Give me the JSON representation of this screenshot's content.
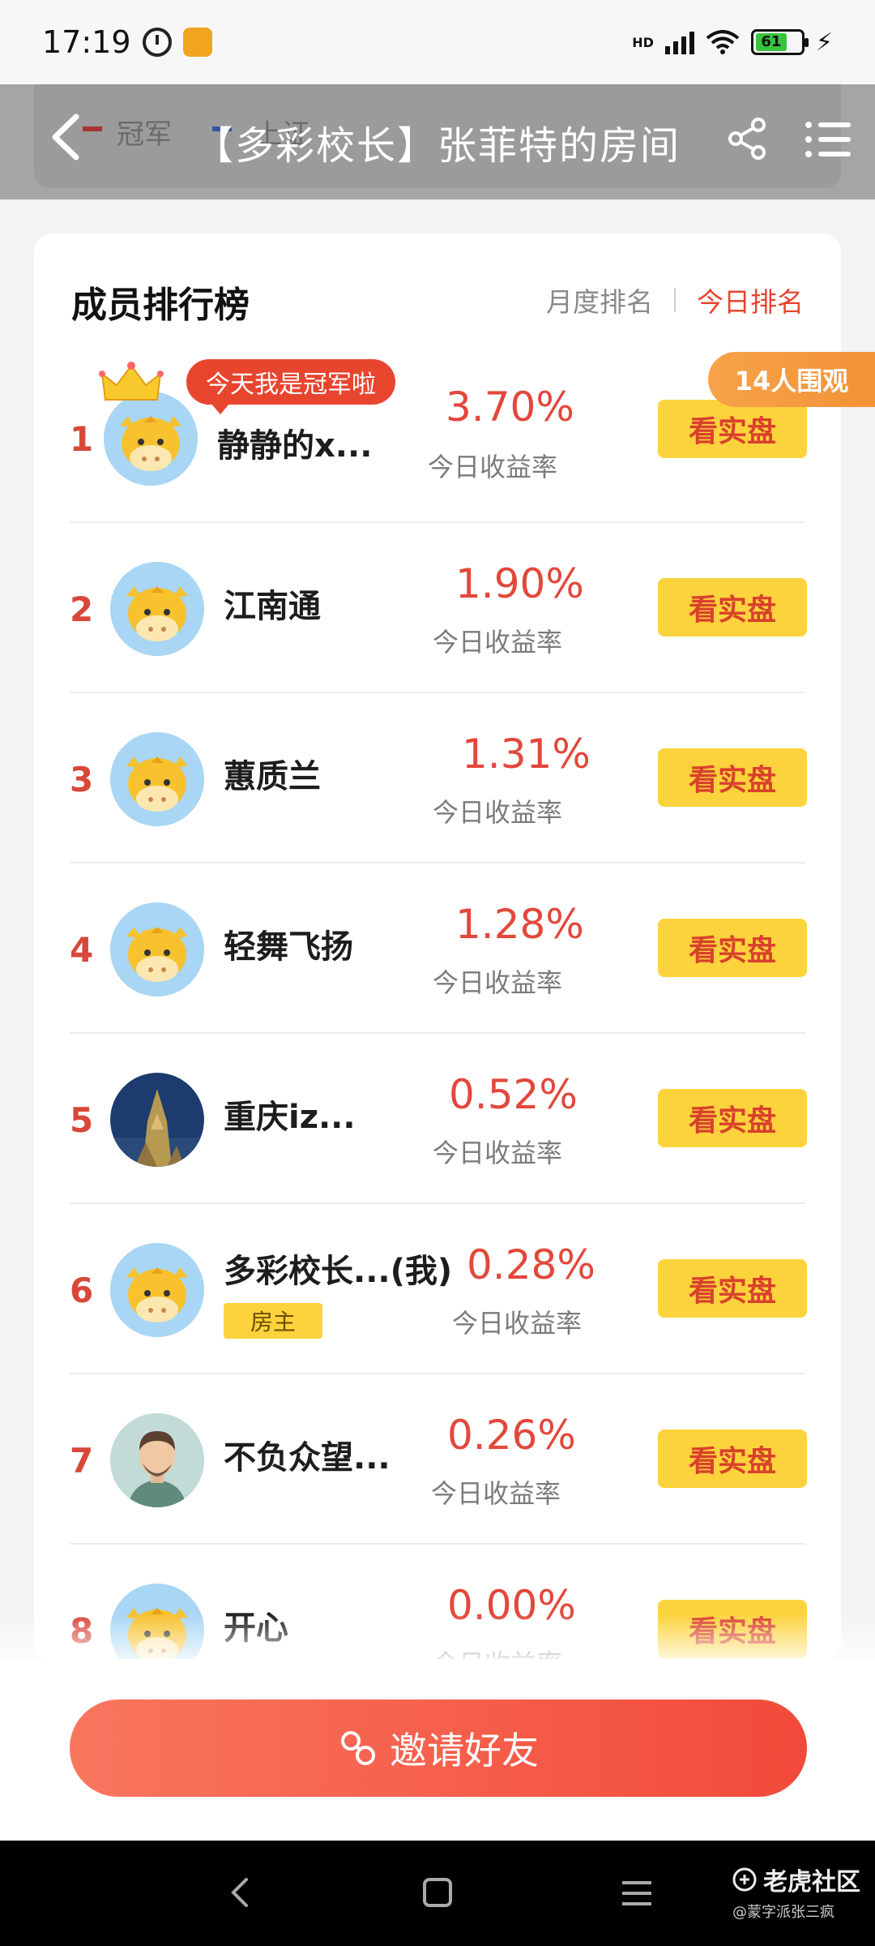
{
  "status_bar": {
    "time": "17:19",
    "network": "HD",
    "battery": "61"
  },
  "header": {
    "title": "【多彩校长】张菲特的房间",
    "ghost_tabs": [
      "冠军",
      "上证"
    ]
  },
  "card": {
    "title": "成员排行榜",
    "tab_month": "月度排名",
    "tab_today": "今日排名",
    "viewers": "14人围观",
    "champion_bubble": "今天我是冠军啦"
  },
  "rate_label": "今日收益率",
  "view_button": "看实盘",
  "members": [
    {
      "rank": "1",
      "name": "静静的x...",
      "rate": "3.70%",
      "avatar": "cow"
    },
    {
      "rank": "2",
      "name": "江南通",
      "rate": "1.90%",
      "avatar": "cow"
    },
    {
      "rank": "3",
      "name": "蕙质兰",
      "rate": "1.31%",
      "avatar": "cow"
    },
    {
      "rank": "4",
      "name": "轻舞飞扬",
      "rate": "1.28%",
      "avatar": "cow"
    },
    {
      "rank": "5",
      "name": "重庆iz...",
      "rate": "0.52%",
      "avatar": "photo"
    },
    {
      "rank": "6",
      "name": "多彩校长...(我)",
      "rate": "0.28%",
      "avatar": "cow",
      "badge": "房主"
    },
    {
      "rank": "7",
      "name": "不负众望...",
      "rate": "0.26%",
      "avatar": "person"
    },
    {
      "rank": "8",
      "name": "开心",
      "rate": "0.00%",
      "avatar": "cow"
    }
  ],
  "invite_button": "邀请好友",
  "watermark": {
    "brand": "老虎社区",
    "user": "@蒙字派张三疯"
  },
  "colors": {
    "accent_red": "#e3473b",
    "button_yellow": "#fcd33c",
    "badge_orange": "#f39237"
  }
}
